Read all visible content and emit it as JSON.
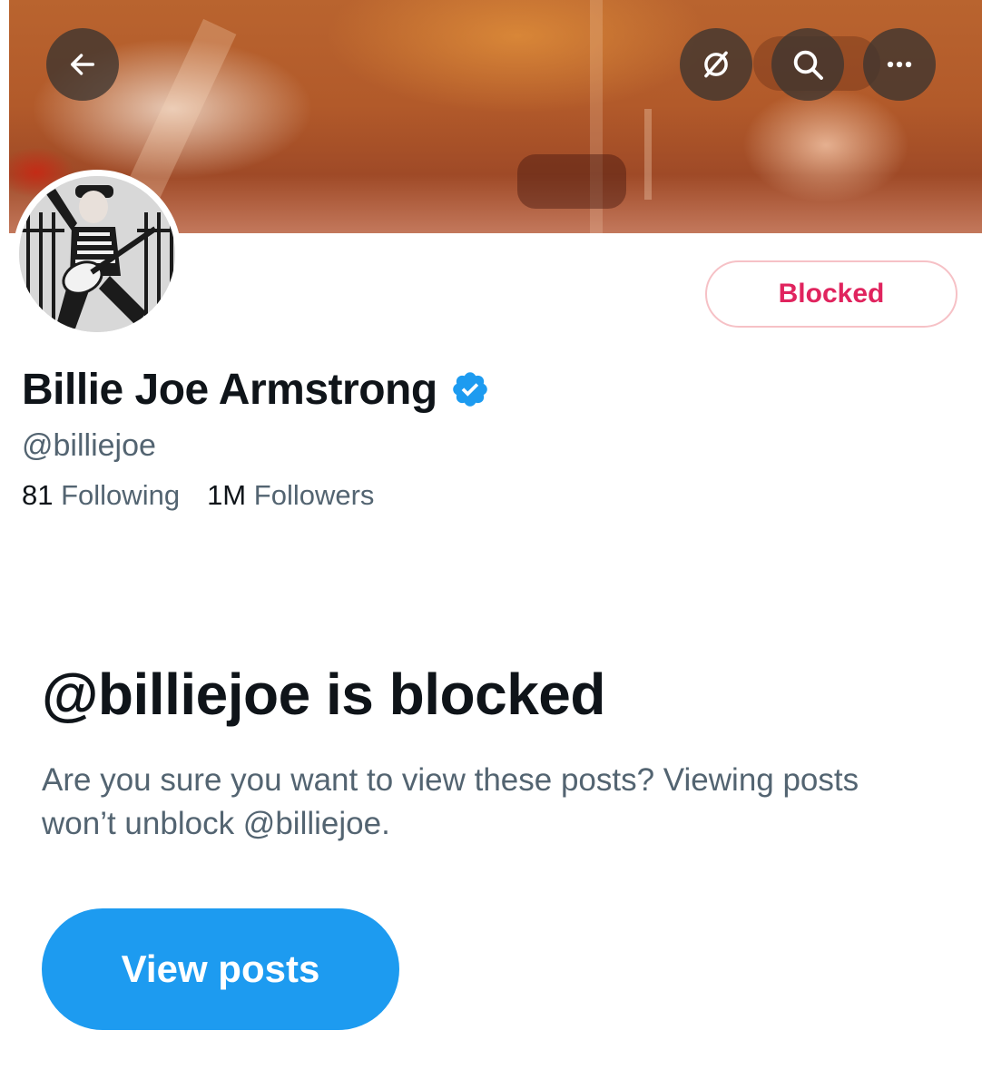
{
  "header": {
    "back_icon": "arrow-left-icon",
    "hide_icon": "eye-slash-icon",
    "search_icon": "search-icon",
    "more_icon": "more-horizontal-icon"
  },
  "profile": {
    "name": "Billie Joe Armstrong",
    "verified": true,
    "handle": "@billiejoe",
    "following_count": "81",
    "following_label": "Following",
    "followers_count": "1M",
    "followers_label": "Followers",
    "blocked_button_label": "Blocked"
  },
  "blocked_notice": {
    "title": "@billiejoe is blocked",
    "description": "Are you sure you want to view these posts? Viewing posts won’t unblock @billiejoe.",
    "view_button_label": "View posts"
  },
  "colors": {
    "accent": "#1d9bf0",
    "blocked_red": "#e0245e",
    "secondary_text": "#536471",
    "primary_text": "#0f1419"
  }
}
